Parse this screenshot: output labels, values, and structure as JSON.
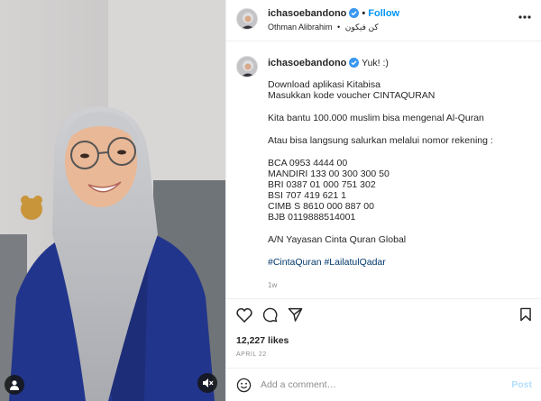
{
  "post": {
    "username": "ichasoebandono",
    "follow_label": "Follow",
    "separator": "•",
    "audio_artist": "Othman Alibrahim",
    "audio_title": "كن فيكون"
  },
  "caption": {
    "first_line": "Yuk! :)",
    "lines": [
      "Download aplikasi Kitabisa",
      "Masukkan kode voucher CINTAQURAN",
      "",
      "Kita bantu 100.000 muslim bisa mengenal Al-Quran",
      "",
      "Atau bisa langsung salurkan melalui nomor rekening :",
      "",
      "BCA 0953 4444 00",
      "MANDIRI 133 00 300 300 50",
      "BRI 0387 01 000 751 302",
      "BSI 707 419 621 1",
      "CIMB S 8610 000 887 00",
      "BJB 0119888514001",
      "",
      "A/N Yayasan Cinta Quran Global",
      ""
    ],
    "hashtags": [
      "#CintaQuran",
      "#LailatulQadar"
    ],
    "age": "1w"
  },
  "stats": {
    "likes": "12,227 likes",
    "date": "APRIL 22"
  },
  "comment_box": {
    "placeholder": "Add a comment…",
    "post_label": "Post"
  },
  "icons": {
    "verified": "verified-badge-icon",
    "more": "more-options-icon",
    "like": "heart-icon",
    "comment": "comment-icon",
    "share": "share-icon",
    "save": "bookmark-icon",
    "emoji": "emoji-icon",
    "user_tag": "user-tag-icon",
    "mute": "muted-speaker-icon"
  },
  "colors": {
    "link": "#0095f6",
    "hashtag": "#00376b",
    "muted_text": "#8e8e8e",
    "post_disabled": "#b2dffc",
    "verified": "#3897f0"
  }
}
